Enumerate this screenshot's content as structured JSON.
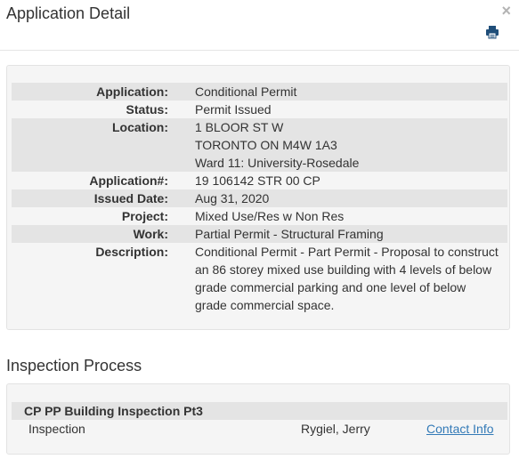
{
  "modal": {
    "title": "Application Detail",
    "close_label": "×",
    "print_icon": "print-icon"
  },
  "details": [
    {
      "label": "Application:",
      "lines": [
        "Conditional Permit"
      ]
    },
    {
      "label": "Status:",
      "lines": [
        "Permit Issued"
      ]
    },
    {
      "label": "Location:",
      "lines": [
        "1 BLOOR ST W",
        "TORONTO ON M4W 1A3",
        "Ward 11: University-Rosedale"
      ]
    },
    {
      "label": "Application#:",
      "lines": [
        "19 106142 STR 00 CP"
      ]
    },
    {
      "label": "Issued Date:",
      "lines": [
        "Aug 31, 2020"
      ]
    },
    {
      "label": "Project:",
      "lines": [
        "Mixed Use/Res w Non Res"
      ]
    },
    {
      "label": "Work:",
      "lines": [
        "Partial Permit - Structural Framing"
      ]
    },
    {
      "label": "Description:",
      "lines": [
        "Conditional Permit - Part Permit - Proposal to construct",
        "an 86 storey mixed use building with 4 levels of below",
        "grade commercial parking and one level of below",
        "grade commercial space."
      ]
    }
  ],
  "inspection": {
    "section_title": "Inspection Process",
    "group_title": "CP PP Building Inspection Pt3",
    "row": {
      "type": "Inspection",
      "inspector": "Rygiel, Jerry",
      "link_label": "Contact Info"
    }
  }
}
